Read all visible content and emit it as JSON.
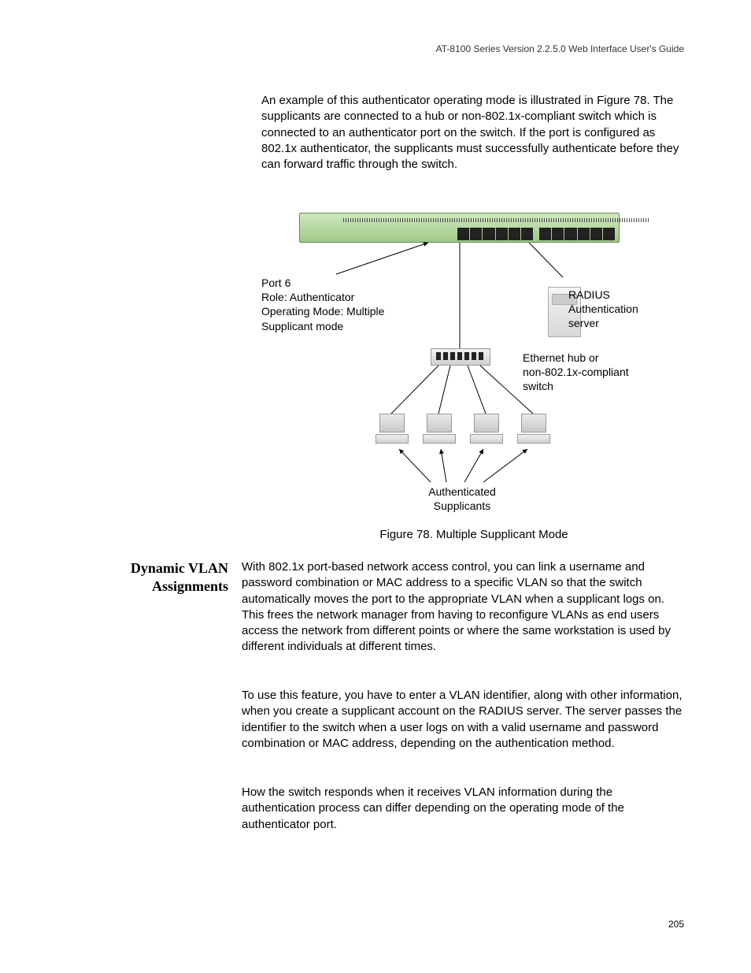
{
  "header": "AT-8100 Series Version 2.2.5.0 Web Interface User's Guide",
  "intro": "An example of this authenticator operating mode is illustrated in Figure 78. The supplicants are connected to a hub or non-802.1x-compliant switch which is connected to an authenticator port on the switch. If the port is configured as 802.1x authenticator, the supplicants must successfully authenticate before they can forward traffic through the switch.",
  "figure": {
    "port_label": {
      "l1": "Port 6",
      "l2": "Role: Authenticator",
      "l3": "Operating Mode: Multiple",
      "l4": "Supplicant mode"
    },
    "radius_label": {
      "l1": "RADIUS",
      "l2": "Authentication",
      "l3": "server"
    },
    "hub_label": {
      "l1": "Ethernet hub or",
      "l2": "non-802.1x-compliant",
      "l3": "switch"
    },
    "supplicants_label": {
      "l1": "Authenticated",
      "l2": "Supplicants"
    },
    "caption": "Figure 78. Multiple Supplicant Mode"
  },
  "section": {
    "heading_l1": "Dynamic VLAN",
    "heading_l2": "Assignments"
  },
  "para1": "With 802.1x port-based network access control, you can link a username and password combination or MAC address to a specific VLAN so that the switch automatically moves the port to the appropriate VLAN when a supplicant logs on. This frees the network manager from having to reconfigure VLANs as end users access the network from different points or where the same workstation is used by different individuals at different times.",
  "para2": "To use this feature, you have to enter a VLAN identifier, along with other information, when you create a supplicant account on the RADIUS server. The server passes the identifier to the switch when a user logs on with a valid username and password combination or MAC address, depending on the authentication method.",
  "para3": "How the switch responds when it receives VLAN information during the authentication process can differ depending on the operating mode of the authenticator port.",
  "page_number": "205"
}
